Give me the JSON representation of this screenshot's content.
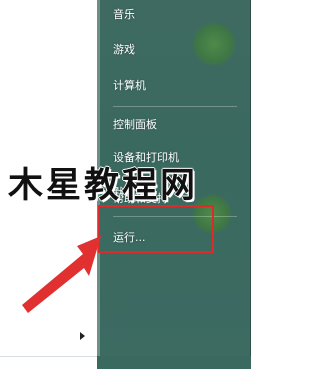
{
  "start_menu": {
    "right_items": [
      {
        "label": "音乐"
      },
      {
        "label": "游戏"
      },
      {
        "label": "计算机"
      },
      {
        "label": "控制面板"
      },
      {
        "label": "设备和打印机"
      },
      {
        "label": "默认程序"
      },
      {
        "label": "帮助和支持"
      },
      {
        "label": "运行..."
      }
    ]
  },
  "watermark": {
    "text": "木星教程网"
  },
  "colors": {
    "right_pane": "#3c6b62",
    "highlight": "#e02a2a",
    "arrow": "#e03030"
  },
  "icons": [
    "chevron-right-icon",
    "annotation-arrow"
  ]
}
